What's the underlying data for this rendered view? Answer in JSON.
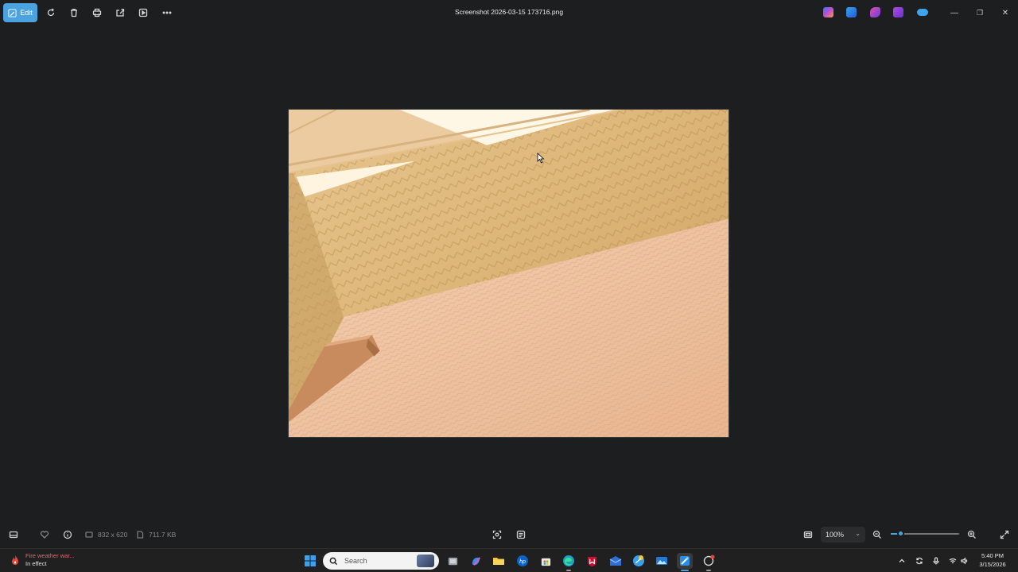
{
  "window": {
    "title": "Screenshot 2026-03-15 173716.png",
    "edit_label": "Edit"
  },
  "status": {
    "dimensions": "832 x 620",
    "file_size": "711.7 KB",
    "zoom_level": "100%",
    "zoom_slider_fraction": 0.14
  },
  "taskbar": {
    "weather_title": "Fire weather war...",
    "weather_subtitle": "In effect",
    "search_placeholder": "Search",
    "time": "5:40 PM",
    "date": "3/15/2026"
  },
  "colors": {
    "accent": "#4aa3df",
    "background": "#1c1e20",
    "taskbar": "#202020"
  },
  "icons": {
    "toolbar": [
      "edit-icon",
      "rotate-icon",
      "delete-icon",
      "print-icon",
      "share-icon",
      "slideshow-icon",
      "more-icon"
    ],
    "titlebar_apps": [
      "copilot-icon",
      "photos-editor-icon",
      "clipchamp-icon",
      "designer-icon",
      "onedrive-icon"
    ],
    "window_controls": [
      "minimize-icon",
      "maximize-icon",
      "close-icon"
    ],
    "bottombar": [
      "filmstrip-icon",
      "favorite-icon",
      "info-icon",
      "dimensions-icon",
      "filesize-icon",
      "visual-search-icon",
      "ocr-icon",
      "fit-icon",
      "zoom-out-icon",
      "zoom-in-icon",
      "fullscreen-icon"
    ]
  }
}
